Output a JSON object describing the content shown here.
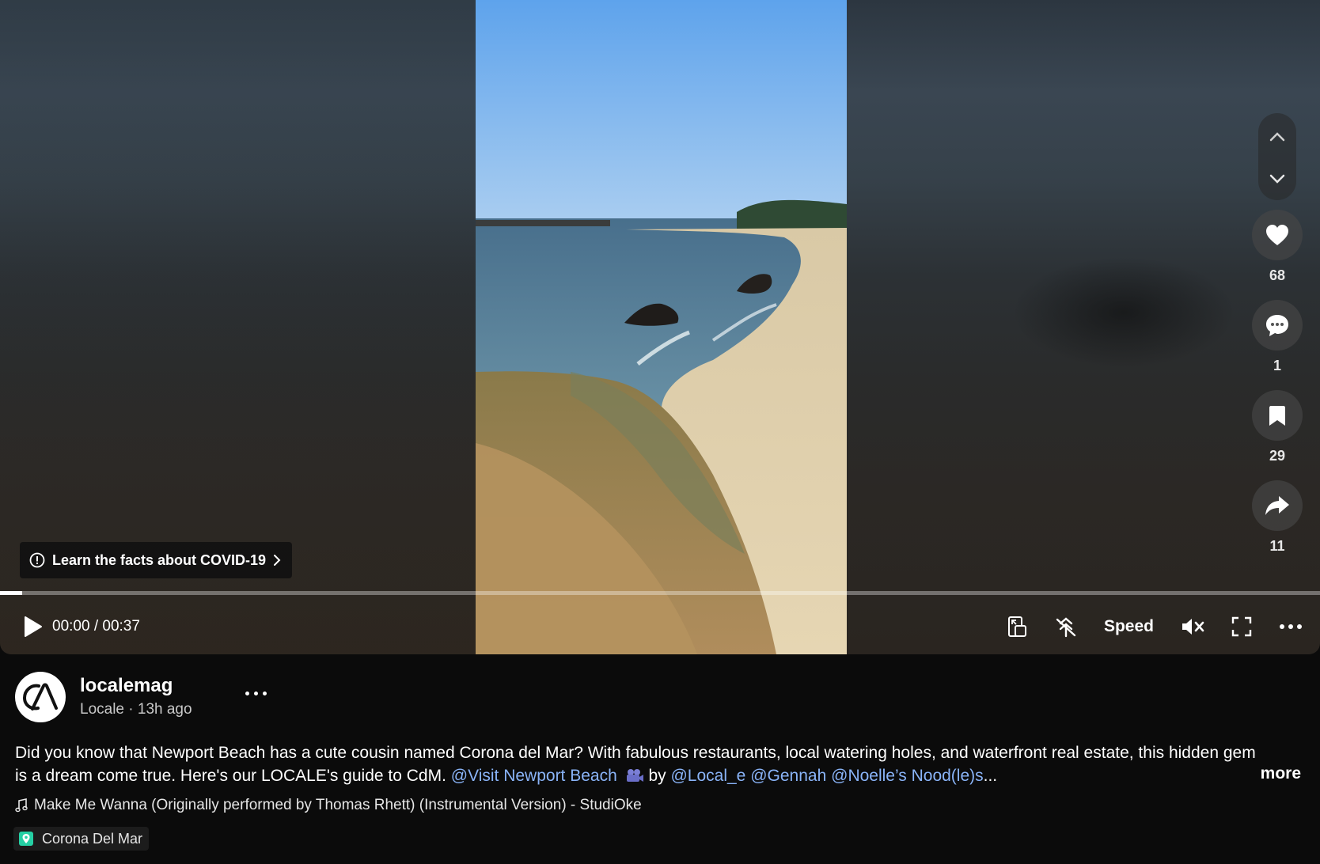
{
  "video": {
    "covid_banner": "Learn the facts about COVID-19",
    "progress_fraction": 0.017,
    "time": "00:00 / 00:37",
    "speed_label": "Speed"
  },
  "actions": {
    "likes": "68",
    "comments": "1",
    "saves": "29",
    "shares": "11"
  },
  "post": {
    "username": "localemag",
    "display_name": "Locale",
    "separator": " · ",
    "posted": "13h ago",
    "caption_text": "Did you know that Newport Beach has a cute cousin named Corona del Mar? With fabulous restaurants, local watering holes, and waterfront real estate, this hidden gem is a dream come true. Here's our LOCALE's guide to CdM. ",
    "mention_1": "@Visit Newport Beach",
    "by_text": " by ",
    "mention_2": "@Local_e",
    "mention_3": "@Gennah",
    "mention_4": "@Noelle’s Nood(le)s",
    "ellipsis": "...",
    "more_label": "more",
    "music": "Make Me Wanna (Originally performed by Thomas Rhett) (Instrumental Version) - StudiOke",
    "location": "Corona Del Mar"
  },
  "colors": {
    "mention": "#8ab4f8",
    "location_pin": "#25d0a4"
  }
}
